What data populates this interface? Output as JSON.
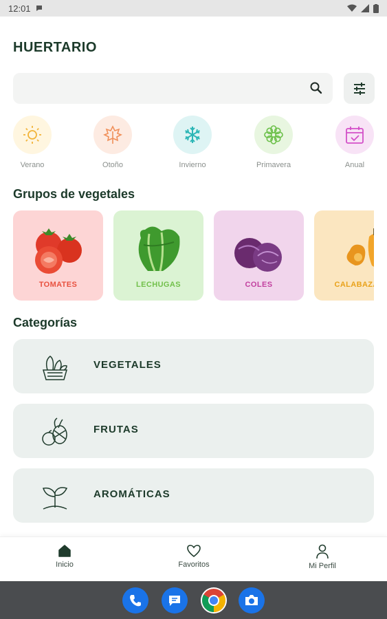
{
  "status_bar": {
    "time": "12:01"
  },
  "app": {
    "title": "HUERTARIO"
  },
  "search": {
    "placeholder": ""
  },
  "seasons": [
    {
      "label": "Verano",
      "icon": "sun-icon",
      "bg": "#fff6e0",
      "color": "#f2b43a"
    },
    {
      "label": "Otoño",
      "icon": "maple-leaf-icon",
      "bg": "#fdebe2",
      "color": "#f0905a"
    },
    {
      "label": "Invierno",
      "icon": "snowflake-icon",
      "bg": "#def4f4",
      "color": "#2cb6b6"
    },
    {
      "label": "Primavera",
      "icon": "flower-icon",
      "bg": "#e8f6e0",
      "color": "#6cc04a"
    },
    {
      "label": "Anual",
      "icon": "calendar-icon",
      "bg": "#f8e3f6",
      "color": "#d34fc8"
    }
  ],
  "groups_title": "Grupos de vegetales",
  "groups": [
    {
      "label": "TOMATES",
      "bg": "#fdd5d5",
      "color": "#e8513f"
    },
    {
      "label": "LECHUGAS",
      "bg": "#dbf3d3",
      "color": "#72c04b"
    },
    {
      "label": "COLES",
      "bg": "#f1d5ec",
      "color": "#c2409f"
    },
    {
      "label": "CALABAZAS",
      "bg": "#fbe6c0",
      "color": "#e9a21a"
    }
  ],
  "categories_title": "Categorías",
  "categories": [
    {
      "label": "VEGETALES",
      "icon": "vegetable-basket-icon"
    },
    {
      "label": "FRUTAS",
      "icon": "fruits-icon"
    },
    {
      "label": "AROMÁTICAS",
      "icon": "sprout-icon"
    }
  ],
  "bottom_nav": [
    {
      "label": "Inicio",
      "icon": "home-icon"
    },
    {
      "label": "Favoritos",
      "icon": "heart-icon"
    },
    {
      "label": "Mi Perfil",
      "icon": "person-icon"
    }
  ],
  "dock": [
    {
      "icon": "phone-icon",
      "color": "#1a73e8"
    },
    {
      "icon": "messages-icon",
      "color": "#1a73e8"
    },
    {
      "icon": "chrome-icon",
      "color": "#ffffff"
    },
    {
      "icon": "camera-icon",
      "color": "#1a73e8"
    }
  ]
}
